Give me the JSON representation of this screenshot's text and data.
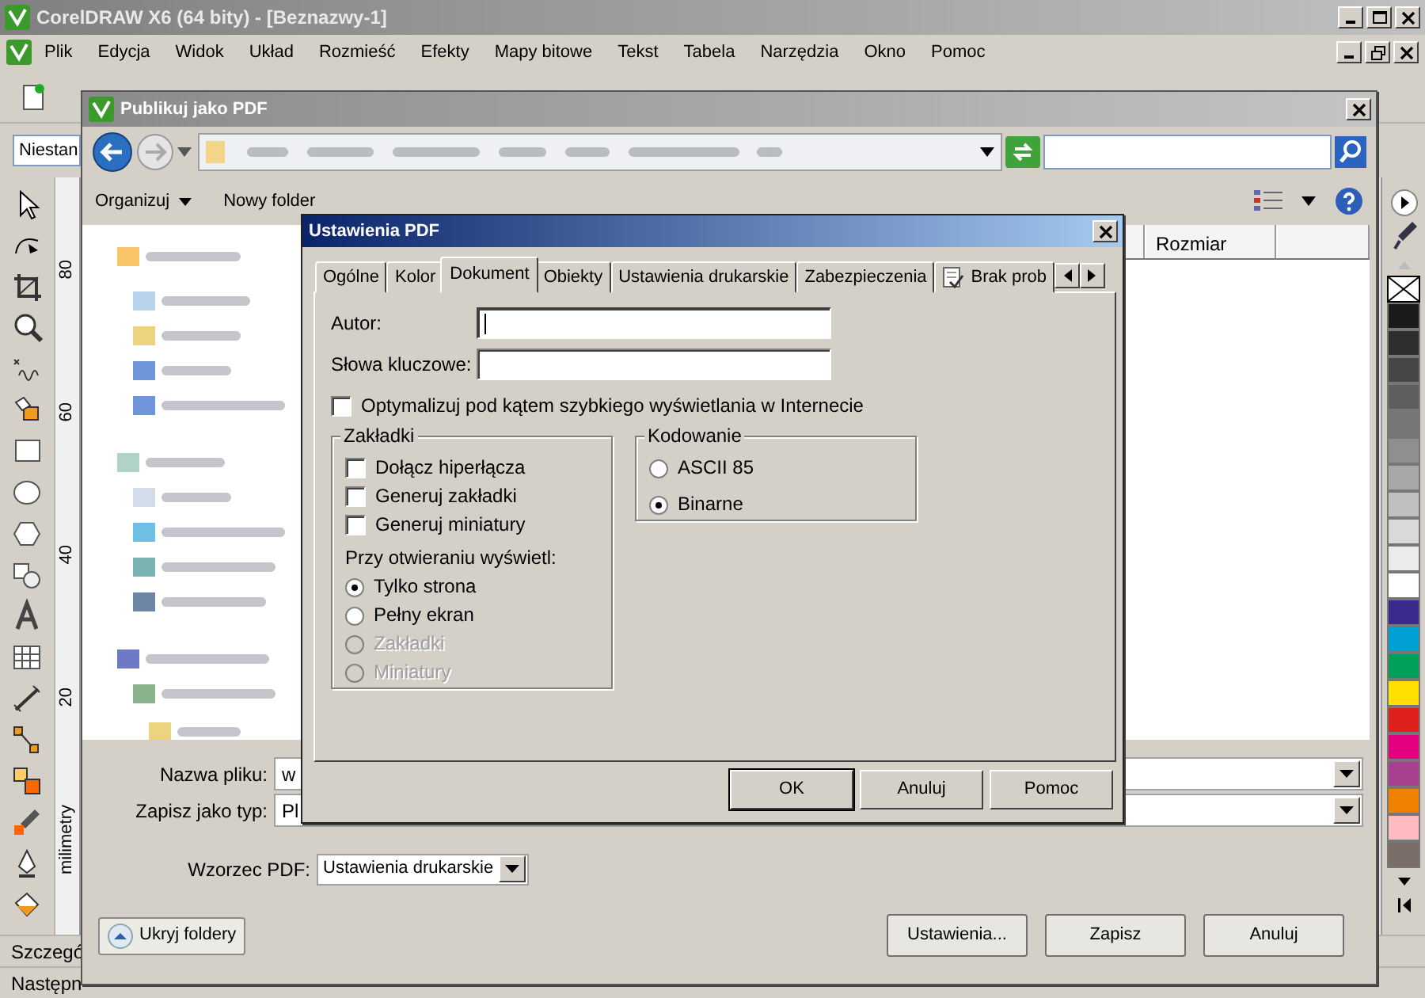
{
  "app_window": {
    "title": "CorelDRAW X6 (64 bity) - [Beznazwy-1]"
  },
  "menu_bar": [
    {
      "label": "Plik"
    },
    {
      "label": "Edycja"
    },
    {
      "label": "Widok"
    },
    {
      "label": "Układ"
    },
    {
      "label": "Rozmieść"
    },
    {
      "label": "Efekty"
    },
    {
      "label": "Mapy bitowe"
    },
    {
      "label": "Tekst"
    },
    {
      "label": "Tabela"
    },
    {
      "label": "Narzędzia"
    },
    {
      "label": "Okno"
    },
    {
      "label": "Pomoc"
    }
  ],
  "property_bar": {
    "combo_text": "Niestan"
  },
  "ruler": {
    "labels": [
      "80",
      "60",
      "40",
      "20"
    ],
    "unit": "milimetry"
  },
  "palette": [
    {
      "kind": "none"
    },
    {
      "kind": "swatch",
      "color": "#1a1a1a"
    },
    {
      "kind": "swatch",
      "color": "#2e2e2e"
    },
    {
      "kind": "swatch",
      "color": "#464646"
    },
    {
      "kind": "swatch",
      "color": "#5f5f5f"
    },
    {
      "kind": "swatch",
      "color": "#777777"
    },
    {
      "kind": "swatch",
      "color": "#8f8f8f"
    },
    {
      "kind": "swatch",
      "color": "#a8a8a8"
    },
    {
      "kind": "swatch",
      "color": "#c0c0c0"
    },
    {
      "kind": "swatch",
      "color": "#d9d9d9"
    },
    {
      "kind": "swatch",
      "color": "#ebebeb"
    },
    {
      "kind": "swatch",
      "color": "#ffffff"
    },
    {
      "kind": "swatch",
      "color": "#3a2a8e"
    },
    {
      "kind": "swatch",
      "color": "#00a0d6"
    },
    {
      "kind": "swatch",
      "color": "#00a05a"
    },
    {
      "kind": "swatch",
      "color": "#ffe000"
    },
    {
      "kind": "swatch",
      "color": "#e0201c"
    },
    {
      "kind": "swatch",
      "color": "#e4007f"
    },
    {
      "kind": "swatch",
      "color": "#a84090"
    },
    {
      "kind": "swatch",
      "color": "#f08000"
    },
    {
      "kind": "swatch",
      "color": "#ffbcc0"
    },
    {
      "kind": "swatch",
      "color": "#7a6e68"
    }
  ],
  "status_bar": [
    "Szczegó",
    "Następn"
  ],
  "publish_dialog": {
    "title": "Publikuj jako PDF",
    "toolbar": [
      {
        "label": "Organizuj",
        "menu": true
      },
      {
        "label": "Nowy folder",
        "menu": false
      }
    ],
    "column_header": "Rozmiar",
    "fields": [
      {
        "label": "Nazwa pliku:",
        "value": "w"
      },
      {
        "label": "Zapisz jako typ:",
        "value": "Pl"
      }
    ],
    "preset": {
      "label": "Wzorzec PDF:",
      "value": "Ustawienia drukarskie"
    },
    "hide_folders": "Ukryj foldery",
    "buttons": [
      "Ustawienia...",
      "Zapisz",
      "Anuluj"
    ]
  },
  "settings_dialog": {
    "title": "Ustawienia PDF",
    "tabs": [
      {
        "label": "Ogólne",
        "selected": false,
        "kind": "text"
      },
      {
        "label": "Kolor",
        "selected": false,
        "kind": "text"
      },
      {
        "label": "Dokument",
        "selected": true,
        "kind": "text"
      },
      {
        "label": "Obiekty",
        "selected": false,
        "kind": "text"
      },
      {
        "label": "Ustawienia drukarskie",
        "selected": false,
        "kind": "text"
      },
      {
        "label": "Zabezpieczenia",
        "selected": false,
        "kind": "text"
      },
      {
        "label": "Brak prob",
        "selected": false,
        "kind": "icon"
      }
    ],
    "fields": [
      {
        "label": "Autor:",
        "focused": true
      },
      {
        "label": "Słowa kluczowe:",
        "focused": false
      }
    ],
    "optimize": {
      "label": "Optymalizuj pod kątem szybkiego wyświetlania w Internecie",
      "checked": false
    },
    "bookmarks_group": {
      "title": "Zakładki",
      "options": [
        {
          "label": "Dołącz hiperłącza",
          "checked": false
        },
        {
          "label": "Generuj zakładki",
          "checked": false
        },
        {
          "label": "Generuj miniatury",
          "checked": false
        }
      ],
      "open_label": "Przy otwieraniu wyświetl:",
      "open_options": [
        {
          "label": "Tylko strona",
          "selected": true,
          "disabled": false
        },
        {
          "label": "Pełny ekran",
          "selected": false,
          "disabled": false
        },
        {
          "label": "Zakładki",
          "selected": false,
          "disabled": true
        },
        {
          "label": "Miniatury",
          "selected": false,
          "disabled": true
        }
      ]
    },
    "encoding_group": {
      "title": "Kodowanie",
      "options": [
        {
          "label": "ASCII 85",
          "selected": false
        },
        {
          "label": "Binarne",
          "selected": true
        }
      ]
    },
    "buttons": [
      {
        "label": "OK",
        "default": true
      },
      {
        "label": "Anuluj",
        "default": false
      },
      {
        "label": "Pomoc",
        "default": false
      }
    ]
  }
}
